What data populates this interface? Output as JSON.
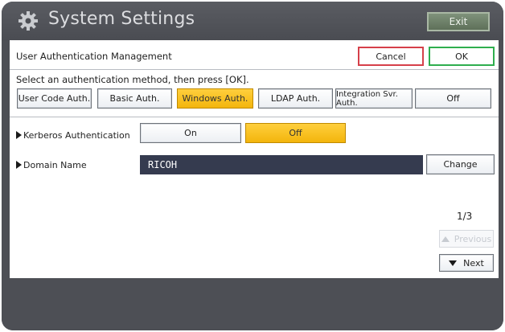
{
  "titlebar": {
    "title": "System Settings",
    "exit_label": "Exit"
  },
  "header": {
    "section_title": "User Authentication Management",
    "cancel_label": "Cancel",
    "ok_label": "OK"
  },
  "auth_methods": {
    "instruction": "Select an authentication method, then press [OK].",
    "options": [
      "User Code Auth.",
      "Basic Auth.",
      "Windows Auth.",
      "LDAP Auth.",
      "Integration Svr. Auth.",
      "Off"
    ],
    "selected": "Windows Auth."
  },
  "kerberos": {
    "label": "Kerberos Authentication",
    "on_label": "On",
    "off_label": "Off",
    "selected": "Off"
  },
  "domain": {
    "label": "Domain Name",
    "value": "RICOH",
    "change_label": "Change"
  },
  "pagination": {
    "indicator": "1/3",
    "previous_label": "Previous",
    "next_label": "Next"
  },
  "colors": {
    "selected_fill": "#f7bd14",
    "cancel_border": "#d6404a",
    "ok_border": "#2fae4e",
    "field_bg": "#353b4f",
    "bezel": "#4d4f55"
  }
}
